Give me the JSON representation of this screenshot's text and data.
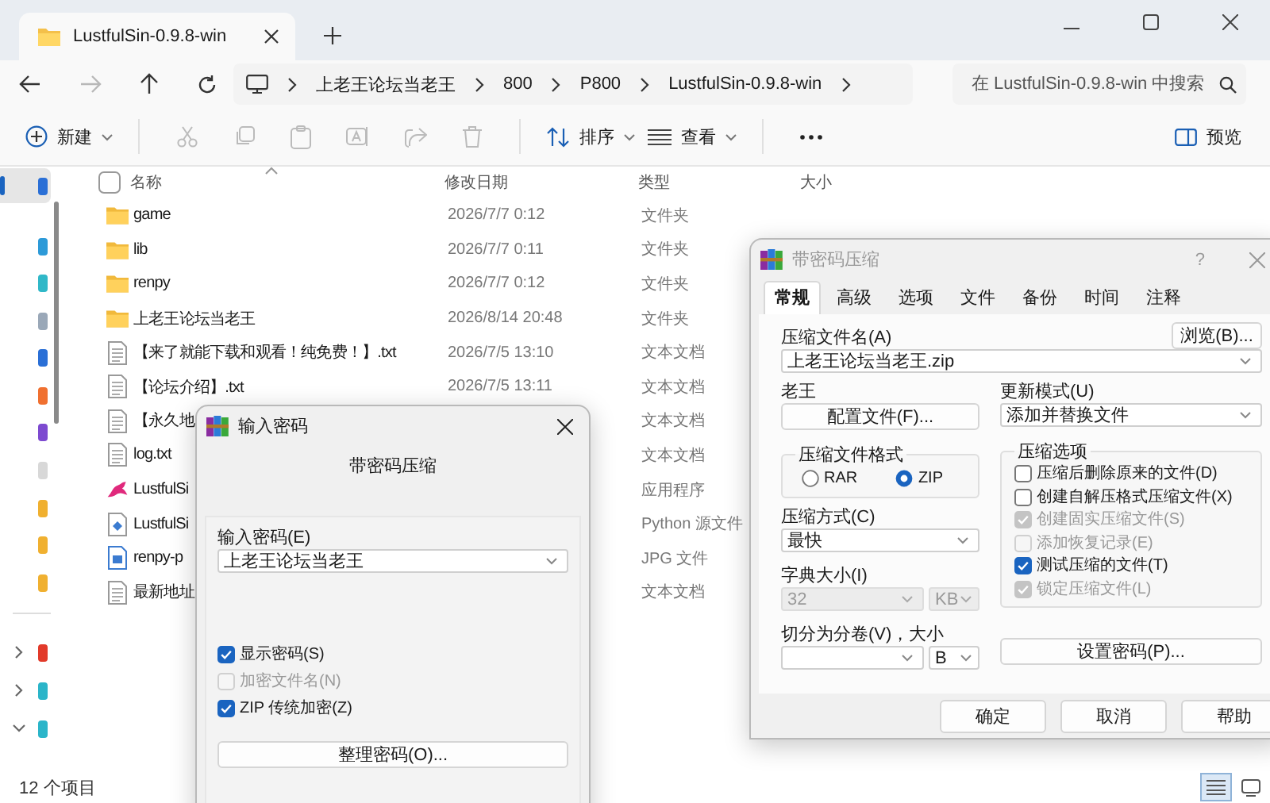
{
  "explorer": {
    "tab": {
      "title": "LustfulSin-0.9.8-win"
    },
    "nav": {
      "forward_disabled": true
    },
    "address": {
      "crumbs": [
        "上老王论坛当老王",
        "800",
        "P800",
        "LustfulSin-0.9.8-win"
      ]
    },
    "search": {
      "placeholder": "在 LustfulSin-0.9.8-win 中搜索"
    },
    "toolbar": {
      "new": "新建",
      "sort": "排序",
      "view": "查看",
      "preview": "预览"
    },
    "sidebar": {
      "items": [
        {
          "color": "#2a6fd6",
          "selected": true
        },
        {
          "color": "#2d9ad8",
          "selected": false
        },
        {
          "color": "#30b8c8",
          "selected": false
        },
        {
          "color": "#9aa8b8",
          "selected": false
        },
        {
          "color": "#2a6fd6",
          "selected": false
        },
        {
          "color": "#f07030",
          "selected": false
        },
        {
          "color": "#7d4ad0",
          "selected": false
        },
        {
          "color": "#d8d8d8",
          "selected": false
        },
        {
          "color": "#f0b030",
          "selected": false
        },
        {
          "color": "#f0b030",
          "selected": false
        },
        {
          "color": "#f0b030",
          "selected": false
        }
      ],
      "tree": [
        {
          "color": "#e23a2a",
          "expanded": false
        },
        {
          "color": "#2bb5c9",
          "expanded": false
        },
        {
          "color": "#2bb5c9",
          "expanded": true
        }
      ]
    },
    "select_all": {
      "checked": false
    },
    "columns": [
      "名称",
      "修改日期",
      "类型",
      "大小"
    ],
    "files": [
      {
        "name": "game",
        "date": "2026/7/7 0:12",
        "type": "文件夹",
        "kind": "folder"
      },
      {
        "name": "lib",
        "date": "2026/7/7 0:11",
        "type": "文件夹",
        "kind": "folder"
      },
      {
        "name": "renpy",
        "date": "2026/7/7 0:12",
        "type": "文件夹",
        "kind": "folder"
      },
      {
        "name": "上老王论坛当老王",
        "date": "2026/8/14 20:48",
        "type": "文件夹",
        "kind": "folder"
      },
      {
        "name": "【来了就能下载和观看！纯免费！】.txt",
        "date": "2026/7/5 13:10",
        "type": "文本文档",
        "kind": "text"
      },
      {
        "name": "【论坛介绍】.txt",
        "date": "2026/7/5 13:11",
        "type": "文本文档",
        "kind": "text"
      },
      {
        "name": "【永久地",
        "type": "文本文档",
        "kind": "text"
      },
      {
        "name": "log.txt",
        "type": "文本文档",
        "kind": "text"
      },
      {
        "name": "LustfulSi",
        "type": "应用程序",
        "kind": "app"
      },
      {
        "name": "LustfulSi",
        "type": "Python 源文件",
        "kind": "python"
      },
      {
        "name": "renpy-p",
        "type": "JPG 文件",
        "kind": "image"
      },
      {
        "name": "最新地址",
        "type": "文本文档",
        "kind": "text"
      }
    ],
    "status_bar": "12 个项目",
    "view_modes": [
      {
        "kind": "details",
        "selected": true
      },
      {
        "kind": "tiles",
        "selected": false
      }
    ]
  },
  "password_dialog": {
    "title": "输入密码",
    "active": true,
    "heading": "带密码压缩",
    "password_label": "输入密码(E)",
    "password_value": "上老王论坛当老王",
    "options": [
      {
        "label": "显示密码(S)",
        "checked": true,
        "disabled": false
      },
      {
        "label": "加密文件名(N)",
        "checked": false,
        "disabled": true
      },
      {
        "label": "ZIP 传统加密(Z)",
        "checked": true,
        "disabled": false
      }
    ],
    "organize_button": "整理密码(O)..."
  },
  "archive_dialog": {
    "title": "带密码压缩",
    "active": false,
    "help": "?",
    "tabs": [
      {
        "label": "常规",
        "selected": true
      },
      {
        "label": "高级",
        "selected": false
      },
      {
        "label": "选项",
        "selected": false
      },
      {
        "label": "文件",
        "selected": false
      },
      {
        "label": "备份",
        "selected": false
      },
      {
        "label": "时间",
        "selected": false
      },
      {
        "label": "注释",
        "selected": false
      }
    ],
    "archive_name_label": "压缩文件名(A)",
    "browse_button": "浏览(B)...",
    "archive_name": "上老王论坛当老王.zip",
    "profile_label": "老王",
    "profile_button": "配置文件(F)...",
    "update_label": "更新模式(U)",
    "update_mode": "添加并替换文件",
    "format_group": "压缩文件格式",
    "formats": [
      {
        "label": "RAR",
        "selected": false
      },
      {
        "label": "ZIP",
        "selected": true
      }
    ],
    "options_group": "压缩选项",
    "options": [
      {
        "label": "压缩后删除原来的文件(D)",
        "checked": false,
        "disabled": false
      },
      {
        "label": "创建自解压格式压缩文件(X)",
        "checked": false,
        "disabled": false
      },
      {
        "label": "创建固实压缩文件(S)",
        "checked": true,
        "disabled": true
      },
      {
        "label": "添加恢复记录(E)",
        "checked": false,
        "disabled": true
      },
      {
        "label": "测试压缩的文件(T)",
        "checked": true,
        "disabled": false
      },
      {
        "label": "锁定压缩文件(L)",
        "checked": true,
        "disabled": true
      }
    ],
    "method_label": "压缩方式(C)",
    "method": "最快",
    "dictionary": {
      "label": "字典大小(I)",
      "value": "32",
      "unit": "KB",
      "disabled": true
    },
    "volume": {
      "label": "切分为分卷(V)，大小",
      "unit": "B"
    },
    "password_button": "设置密码(P)...",
    "buttons": [
      "确定",
      "取消",
      "帮助"
    ]
  }
}
